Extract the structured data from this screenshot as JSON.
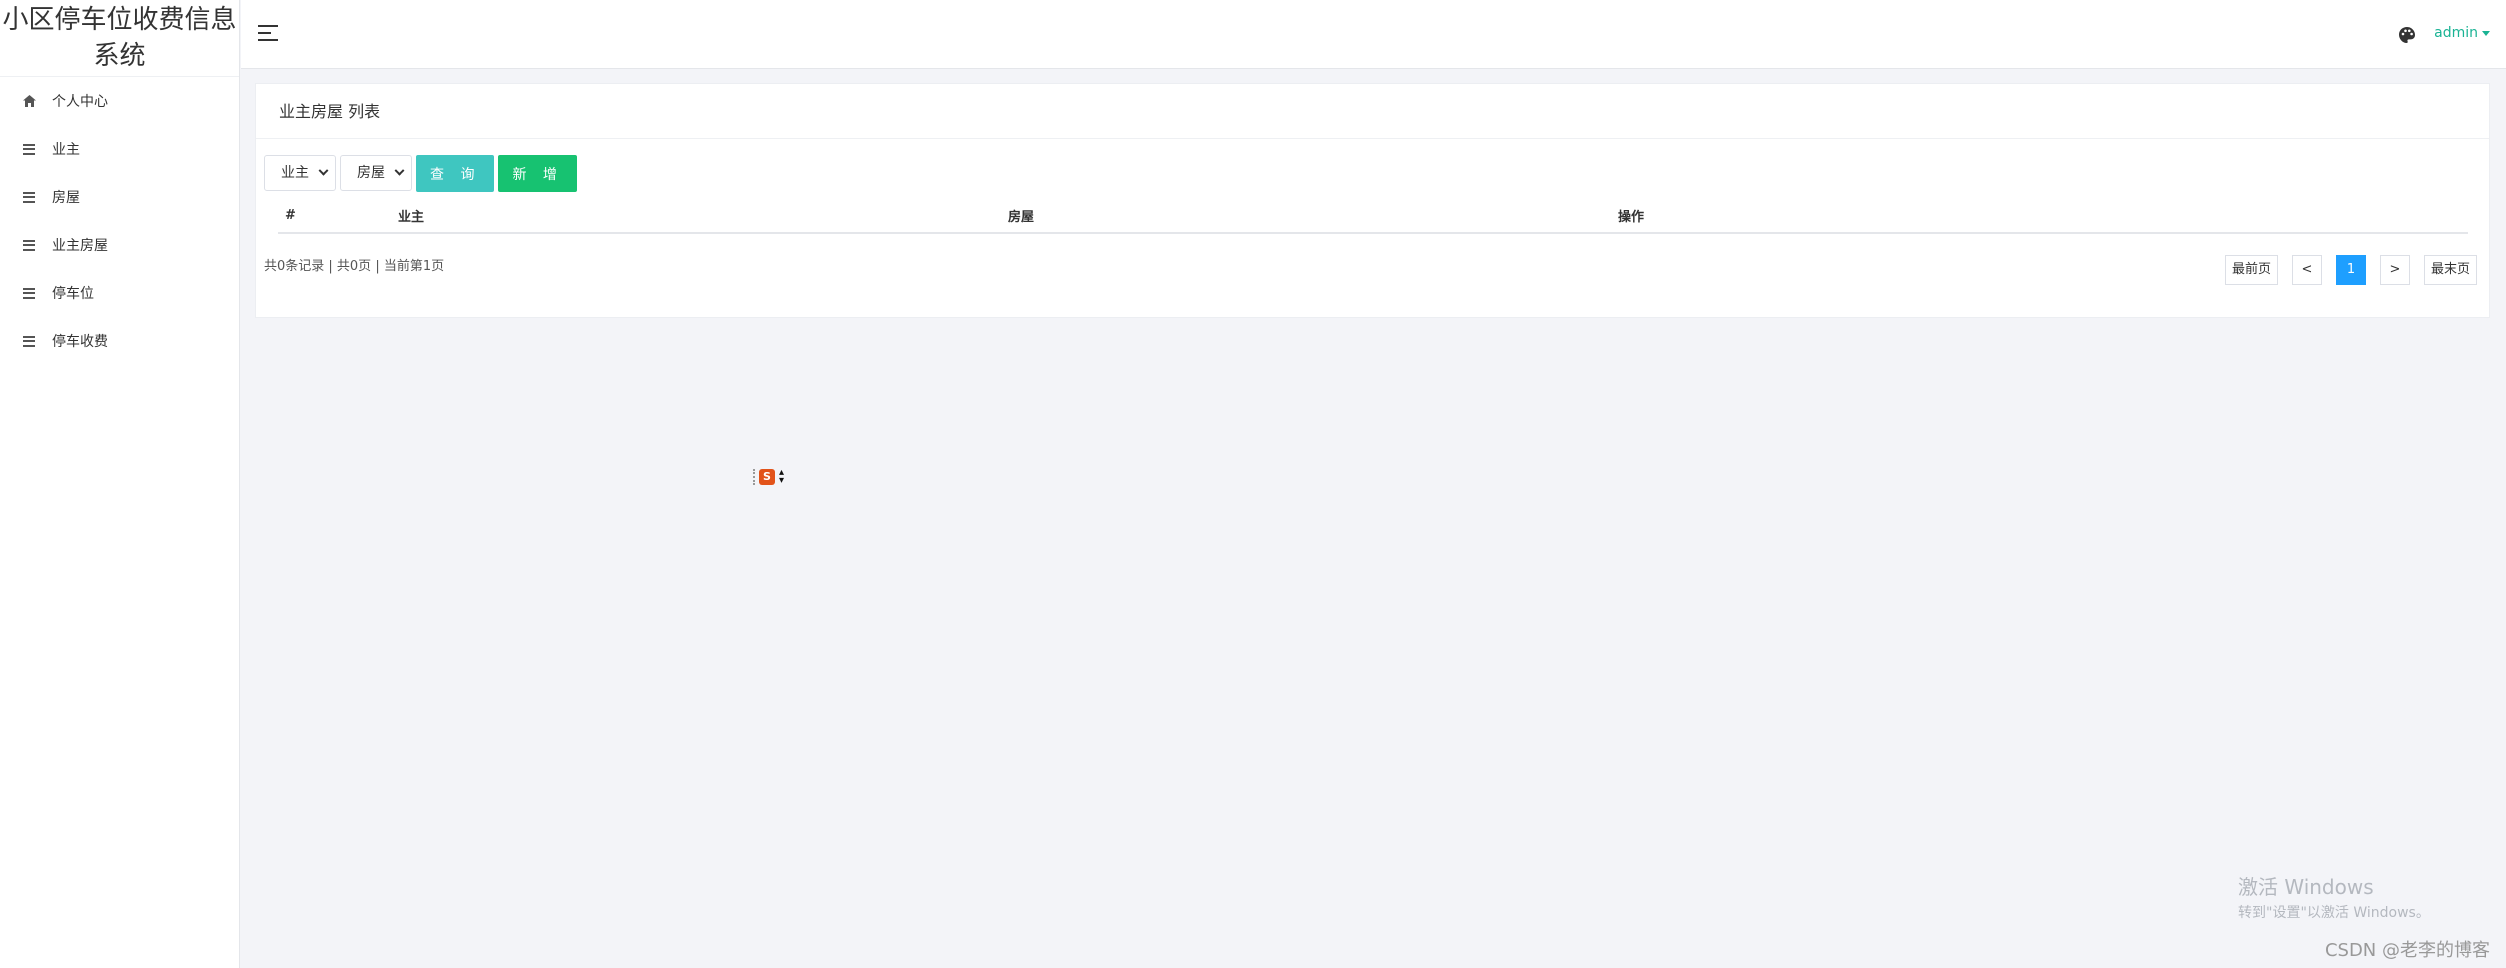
{
  "app": {
    "title": "小区停车位收费信息系统"
  },
  "sidebar": {
    "items": [
      {
        "label": "个人中心",
        "icon": "home-icon"
      },
      {
        "label": "业主",
        "icon": "list-icon"
      },
      {
        "label": "房屋",
        "icon": "list-icon"
      },
      {
        "label": "业主房屋",
        "icon": "list-icon"
      },
      {
        "label": "停车位",
        "icon": "list-icon"
      },
      {
        "label": "停车收费",
        "icon": "list-icon"
      }
    ]
  },
  "header": {
    "user": "admin"
  },
  "page": {
    "title": "业主房屋 列表",
    "filters": {
      "owner": "业主",
      "house": "房屋"
    },
    "buttons": {
      "query": "查 询",
      "add": "新 增"
    },
    "table": {
      "columns": [
        "#",
        "业主",
        "房屋",
        "操作"
      ],
      "rows": []
    },
    "pager": {
      "info": "共0条记录 | 共0页 | 当前第1页",
      "first": "最前页",
      "prev": "<",
      "current": "1",
      "next": ">",
      "last": "最末页"
    }
  },
  "watermark": {
    "activate_title": "激活 Windows",
    "activate_sub": "转到\"设置\"以激活 Windows。",
    "csdn": "CSDN @老李的博客"
  },
  "colors": {
    "accent": "#1ab394",
    "query": "#3fc6c0",
    "add": "#17c271",
    "pager_active": "#1e9fff"
  }
}
